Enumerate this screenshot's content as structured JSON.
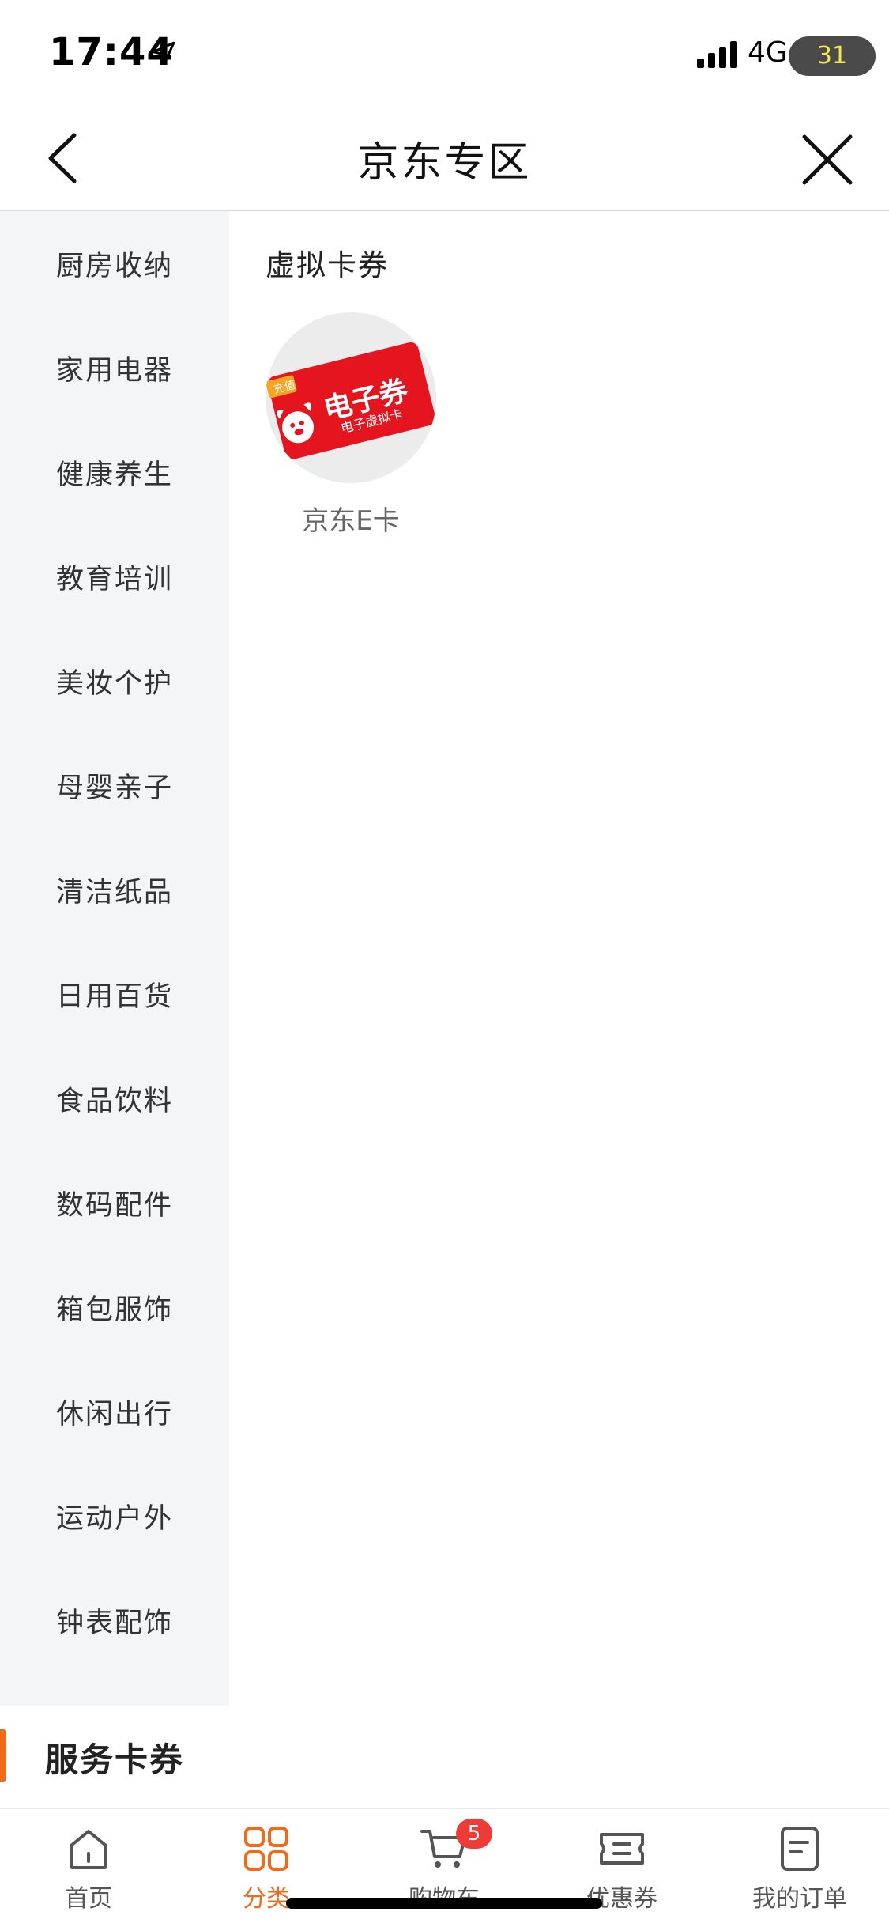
{
  "status_bar": {
    "time": "17:44",
    "network": "4G",
    "battery": "31"
  },
  "nav": {
    "title": "京东专区"
  },
  "sidebar": {
    "items": [
      {
        "label": "厨房收纳"
      },
      {
        "label": "家用电器"
      },
      {
        "label": "健康养生"
      },
      {
        "label": "教育培训"
      },
      {
        "label": "美妆个护"
      },
      {
        "label": "母婴亲子"
      },
      {
        "label": "清洁纸品"
      },
      {
        "label": "日用百货"
      },
      {
        "label": "食品饮料"
      },
      {
        "label": "数码配件"
      },
      {
        "label": "箱包服饰"
      },
      {
        "label": "休闲出行"
      },
      {
        "label": "运动户外"
      },
      {
        "label": "钟表配饰"
      },
      {
        "label": "服务卡券"
      }
    ],
    "active_index": 14
  },
  "content": {
    "section_title": "虚拟卡券",
    "product": {
      "label": "京东E卡",
      "image_text": {
        "tag": "充值",
        "main": "电子券",
        "sub": "电子虚拟卡"
      }
    }
  },
  "tabbar": {
    "tabs": [
      {
        "label": "首页",
        "icon": "home-icon"
      },
      {
        "label": "分类",
        "icon": "category-icon"
      },
      {
        "label": "购物车",
        "icon": "cart-icon"
      },
      {
        "label": "优惠券",
        "icon": "coupon-icon"
      },
      {
        "label": "我的订单",
        "icon": "order-icon"
      }
    ],
    "active_index": 1,
    "cart_badge": "5"
  },
  "colors": {
    "accent": "#f06a1c",
    "badge": "#ef3b36",
    "sidebar_bg": "#f4f5f7",
    "card_red": "#e4151f"
  }
}
